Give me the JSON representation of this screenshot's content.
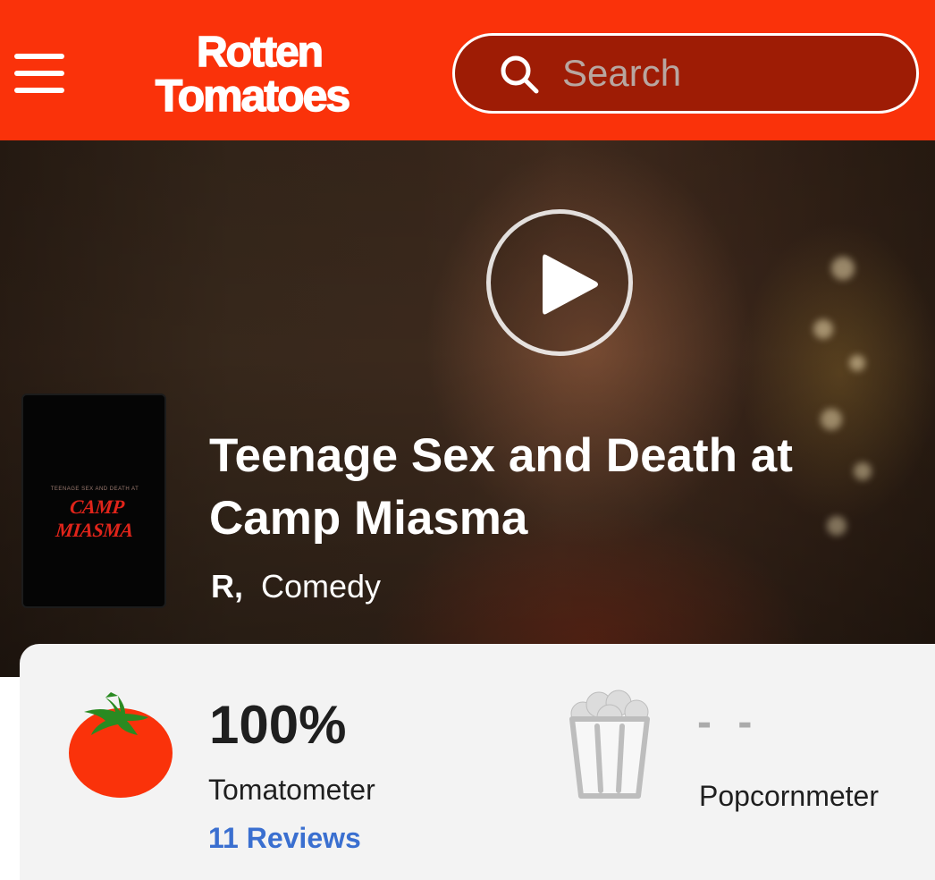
{
  "header": {
    "logo_line1": "Rotten",
    "logo_line2": "Tomatoes",
    "search": {
      "placeholder": "Search",
      "value": ""
    },
    "colors": {
      "brand": "#fa320a",
      "search_bg": "#9e1c05"
    }
  },
  "hero": {
    "title": "Teenage Sex and Death at Camp Miasma",
    "rating": "R,",
    "genre": "Comedy",
    "poster": {
      "small_text": "TEENAGE SEX AND DEATH AT",
      "title_text": "CAMP MIASMA"
    }
  },
  "scores": {
    "tomatometer": {
      "score": "100%",
      "label": "Tomatometer",
      "reviews": "11 Reviews"
    },
    "popcornmeter": {
      "score": "- -",
      "label": "Popcornmeter"
    },
    "colors": {
      "tomato": "#fa320a",
      "link": "#3a6fd0",
      "empty_score": "#aaaaaa"
    }
  },
  "icons": [
    "menu-icon",
    "search-icon",
    "play-icon",
    "tomato-icon",
    "popcorn-icon"
  ]
}
